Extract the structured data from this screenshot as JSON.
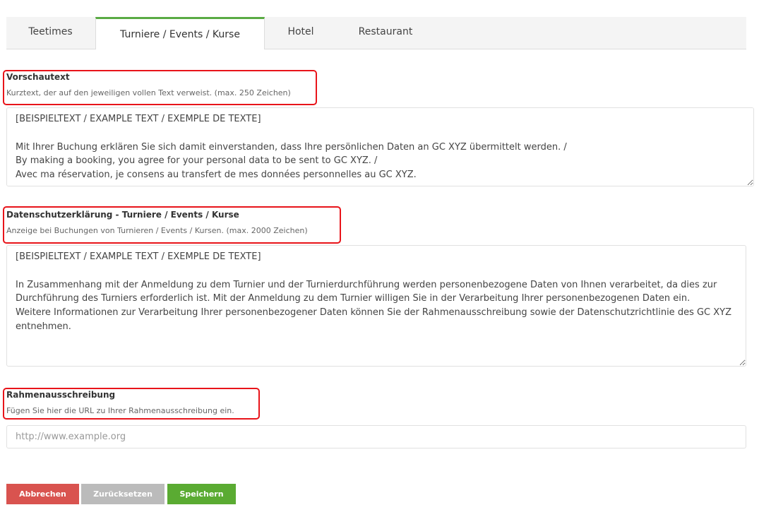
{
  "tabs": [
    {
      "label": "Teetimes"
    },
    {
      "label": "Turniere / Events / Kurse"
    },
    {
      "label": "Hotel"
    },
    {
      "label": "Restaurant"
    }
  ],
  "active_tab": 1,
  "fields": {
    "preview": {
      "title": "Vorschautext",
      "help": "Kurztext, der auf den jeweiligen vollen Text verweist. (max. 250 Zeichen)",
      "value": "[BEISPIELTEXT / EXAMPLE TEXT / EXEMPLE DE TEXTE]\n\nMit Ihrer Buchung erklären Sie sich damit einverstanden, dass Ihre persönlichen Daten an GC XYZ übermittelt werden. /\nBy making a booking, you agree for your personal data to be sent to GC XYZ. /\nAvec ma réservation, je consens au transfert de mes données personnelles au GC XYZ."
    },
    "privacy": {
      "title": "Datenschutzerklärung - Turniere / Events / Kurse",
      "help": "Anzeige bei Buchungen von Turnieren / Events / Kursen. (max. 2000 Zeichen)",
      "value": "[BEISPIELTEXT / EXAMPLE TEXT / EXEMPLE DE TEXTE]\n\nIn Zusammenhang mit der Anmeldung zu dem Turnier und der Turnierdurchführung werden personenbezogene Daten von Ihnen verarbeitet, da dies zur Durchführung des Turniers erforderlich ist. Mit der Anmeldung zu dem Turnier willigen Sie in der Verarbeitung Ihrer personenbezogenen Daten ein.\nWeitere Informationen zur Verarbeitung Ihrer personenbezogener Daten können Sie der Rahmenausschreibung sowie der Datenschutzrichtlinie des GC XYZ entnehmen."
    },
    "tender": {
      "title": "Rahmenausschreibung",
      "help": "Fügen Sie hier die URL zu Ihrer Rahmenausschreibung ein.",
      "value": "",
      "placeholder": "http://www.example.org"
    }
  },
  "buttons": {
    "cancel": "Abbrechen",
    "reset": "Zurücksetzen",
    "save": "Speichern"
  },
  "colors": {
    "active_tab_accent": "#5aab44",
    "highlight": "#e8141a",
    "cancel": "#d9534f",
    "reset": "#bbbbbb",
    "save": "#5aab32"
  }
}
